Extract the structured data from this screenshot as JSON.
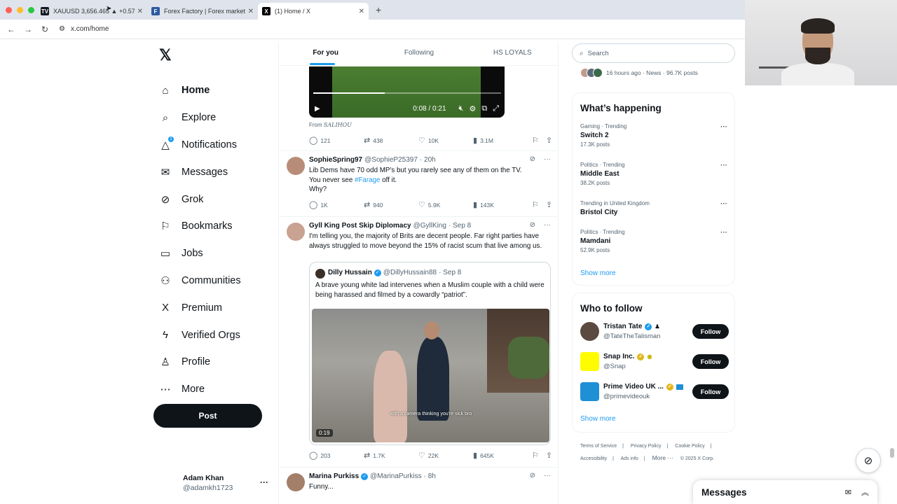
{
  "browser": {
    "tabs": [
      {
        "label": "XAUUSD 3,656.465 ▲ +0.57",
        "icon": "tradingview-icon",
        "color": "#131722"
      },
      {
        "label": "Forex Factory | Forex markets",
        "icon": "forexfactory-icon",
        "color": "#2d5aa0"
      },
      {
        "label": "(1) Home / X",
        "icon": "x-icon",
        "color": "#000000"
      }
    ],
    "url": "x.com/home"
  },
  "nav": {
    "items": [
      {
        "label": "Home",
        "icon": "home-icon",
        "glyph": "⌂"
      },
      {
        "label": "Explore",
        "icon": "search-icon",
        "glyph": "⌕"
      },
      {
        "label": "Notifications",
        "icon": "bell-icon",
        "glyph": "🔔︎",
        "badge": "1"
      },
      {
        "label": "Messages",
        "icon": "mail-icon",
        "glyph": "✉"
      },
      {
        "label": "Grok",
        "icon": "grok-icon",
        "glyph": "⊘"
      },
      {
        "label": "Bookmarks",
        "icon": "bookmark-icon",
        "glyph": "⚐"
      },
      {
        "label": "Jobs",
        "icon": "briefcase-icon",
        "glyph": "▭"
      },
      {
        "label": "Communities",
        "icon": "people-icon",
        "glyph": "⚇"
      },
      {
        "label": "Premium",
        "icon": "x-icon",
        "glyph": "X"
      },
      {
        "label": "Verified Orgs",
        "icon": "lightning-icon",
        "glyph": "ϟ"
      },
      {
        "label": "Profile",
        "icon": "person-icon",
        "glyph": "♙"
      },
      {
        "label": "More",
        "icon": "more-circle-icon",
        "glyph": "⋯"
      }
    ],
    "post": "Post",
    "account": {
      "name": "Adam Khan",
      "handle": "@adamkh1723"
    }
  },
  "feed": {
    "tabs": [
      "For you",
      "Following",
      "HS LOYALS"
    ],
    "video": {
      "time": "0:08 / 0:21",
      "progress": 0.38
    },
    "from_label": "From",
    "from_name": "SALIHOU",
    "first_stats": {
      "replies": "121",
      "reposts": "438",
      "likes": "10K",
      "views": "3.1M"
    },
    "tweets": [
      {
        "name": "SophieSpring97",
        "handle": "@SophieP25397",
        "time": "· 20h",
        "text1": "Lib Dems have 70 odd MP's but you rarely see any of them on the TV.",
        "text2_pre": "You never see ",
        "hashtag": "#Farage",
        "text2_post": " off it.",
        "text3": "Why?",
        "stats": {
          "replies": "1K",
          "reposts": "940",
          "likes": "5.9K",
          "views": "143K"
        }
      },
      {
        "name": "Gyll King Post Skip Diplomacy",
        "handle": "@GyllKing",
        "time": "· Sep 8",
        "text": "I'm telling you, the majority of Brits are decent people. Far right parties have always struggled to move beyond the 15% of racist scum that live among us.",
        "quote": {
          "name": "Dilly Hussain",
          "handle": "@DillyHussain88",
          "time": "· Sep 8",
          "text": "A brave young white lad intervenes when a Muslim couple with a child were being harassed and filmed by a cowardly “patriot”.",
          "caption": "with a camera thinking you're sick bro",
          "duration": "0:19"
        },
        "stats": {
          "replies": "203",
          "reposts": "1.7K",
          "likes": "22K",
          "views": "645K"
        }
      },
      {
        "name": "Marina Purkiss",
        "handle": "@MarinaPurkiss",
        "time": "· 8h",
        "text": "Funny..."
      }
    ]
  },
  "sidebar": {
    "search_placeholder": "Search",
    "news_meta": "16 hours ago · News · 96.7K posts",
    "happening_title": "What’s happening",
    "trends": [
      {
        "meta": "Gaming · Trending",
        "title": "Switch 2",
        "posts": "17.3K posts"
      },
      {
        "meta": "Politics · Trending",
        "title": "Middle East",
        "posts": "38.2K posts"
      },
      {
        "meta": "Trending in United Kingdom",
        "title": "Bristol City",
        "posts": ""
      },
      {
        "meta": "Politics · Trending",
        "title": "Mamdani",
        "posts": "52.9K posts"
      }
    ],
    "show_more": "Show more",
    "follow_title": "Who to follow",
    "follows": [
      {
        "name": "Tristan Tate",
        "handle": "@TateTheTalisman",
        "button": "Follow",
        "color": "#5a4a40"
      },
      {
        "name": "Snap Inc.",
        "handle": "@Snap",
        "button": "Follow",
        "color": "#fffc00"
      },
      {
        "name": "Prime Video UK ...",
        "handle": "@primevideouk",
        "button": "Follow",
        "color": "#1f8fd6"
      }
    ],
    "footer": [
      "Terms of Service",
      "|",
      "Privacy Policy",
      "|",
      "Cookie Policy",
      "|",
      "Accessibility",
      "|",
      "Ads info",
      "|",
      "More ···",
      "© 2025 X Corp."
    ],
    "messages": "Messages"
  }
}
